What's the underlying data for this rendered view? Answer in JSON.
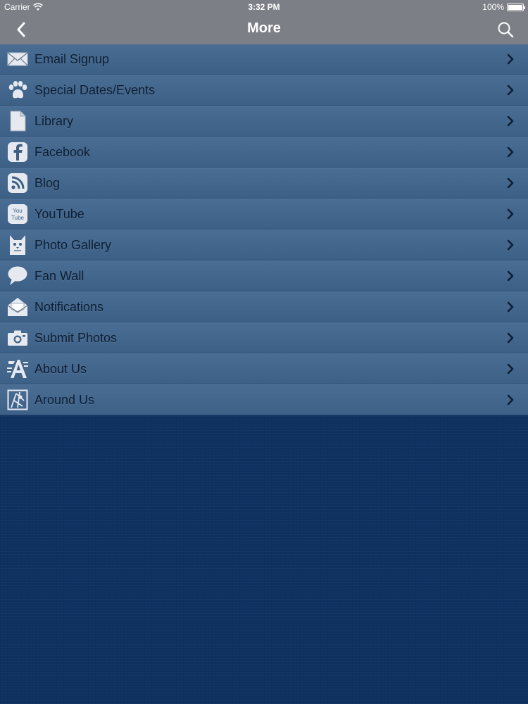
{
  "status_bar": {
    "carrier": "Carrier",
    "time": "3:32 PM",
    "battery": "100%"
  },
  "nav": {
    "title": "More"
  },
  "menu": {
    "items": [
      {
        "label": "Email Signup",
        "icon": "envelope-icon"
      },
      {
        "label": "Special Dates/Events",
        "icon": "paw-icon"
      },
      {
        "label": "Library",
        "icon": "document-icon"
      },
      {
        "label": "Facebook",
        "icon": "facebook-icon"
      },
      {
        "label": "Blog",
        "icon": "rss-icon"
      },
      {
        "label": "YouTube",
        "icon": "youtube-icon"
      },
      {
        "label": "Photo Gallery",
        "icon": "cat-icon"
      },
      {
        "label": "Fan Wall",
        "icon": "speech-bubble-icon"
      },
      {
        "label": "Notifications",
        "icon": "open-envelope-icon"
      },
      {
        "label": "Submit Photos",
        "icon": "camera-icon"
      },
      {
        "label": "About Us",
        "icon": "about-icon"
      },
      {
        "label": "Around Us",
        "icon": "map-icon"
      }
    ]
  },
  "youtube_icon_text": {
    "line1": "You",
    "line2": "Tube"
  },
  "colors": {
    "bar": "#7c7f86",
    "list_bg": "#3f6388",
    "page_bg": "#0f3161",
    "label_text": "#0d1e33",
    "icon_fill": "#e6eaf0"
  }
}
